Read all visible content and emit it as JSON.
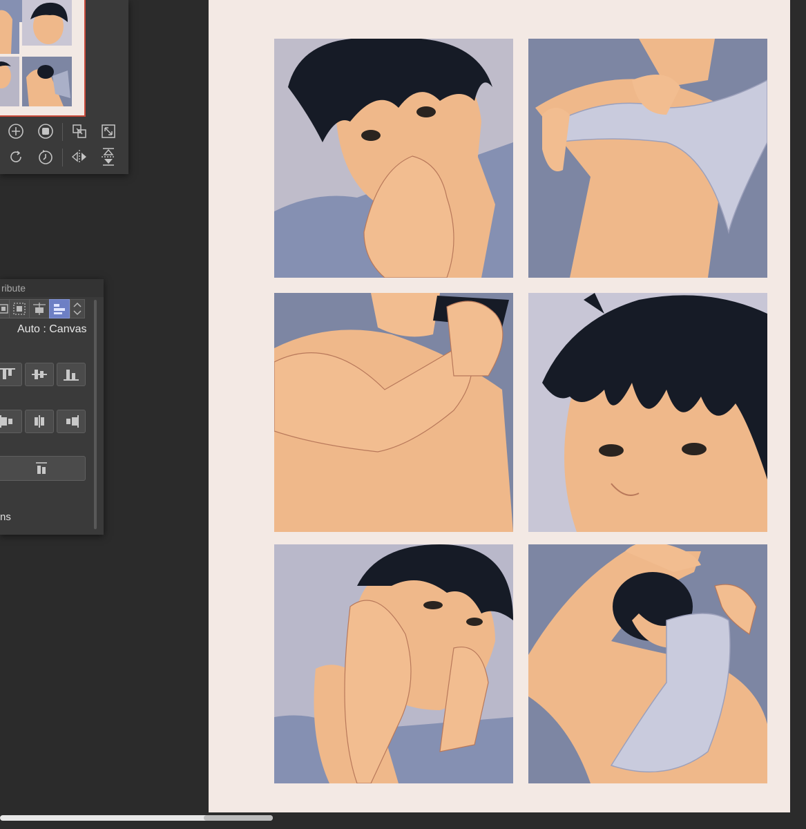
{
  "navigator": {
    "tools": [
      {
        "icon": "zoom-in-icon"
      },
      {
        "icon": "stop-circle-icon"
      },
      {
        "icon": "fit-to-screen-icon"
      },
      {
        "icon": "fit-to-window-icon"
      },
      {
        "icon": "rotate-icon"
      },
      {
        "icon": "reset-rotation-icon"
      },
      {
        "icon": "flip-horizontal-icon"
      },
      {
        "icon": "flip-vertical-icon"
      }
    ]
  },
  "attribute_panel": {
    "title": "ribute",
    "reference_label": "Auto : Canvas",
    "footer_label": "ns",
    "active_mode_index": 3
  },
  "canvas": {
    "colors": {
      "paper": "#f3e9e4",
      "skin": "#efb88a",
      "hair": "#161b26",
      "shirt": "#8590b2",
      "bg_blue": "#7d86a3",
      "bg_lavender": "#b8b6c6"
    },
    "panels": [
      {
        "subject": "boy-hand-on-mouth"
      },
      {
        "subject": "pulling-shirt-over-torso"
      },
      {
        "subject": "shirtless-holding-phone"
      },
      {
        "subject": "face-closeup-looking-up"
      },
      {
        "subject": "face-resting-on-hands"
      },
      {
        "subject": "pulling-shirt-over-head"
      }
    ]
  }
}
